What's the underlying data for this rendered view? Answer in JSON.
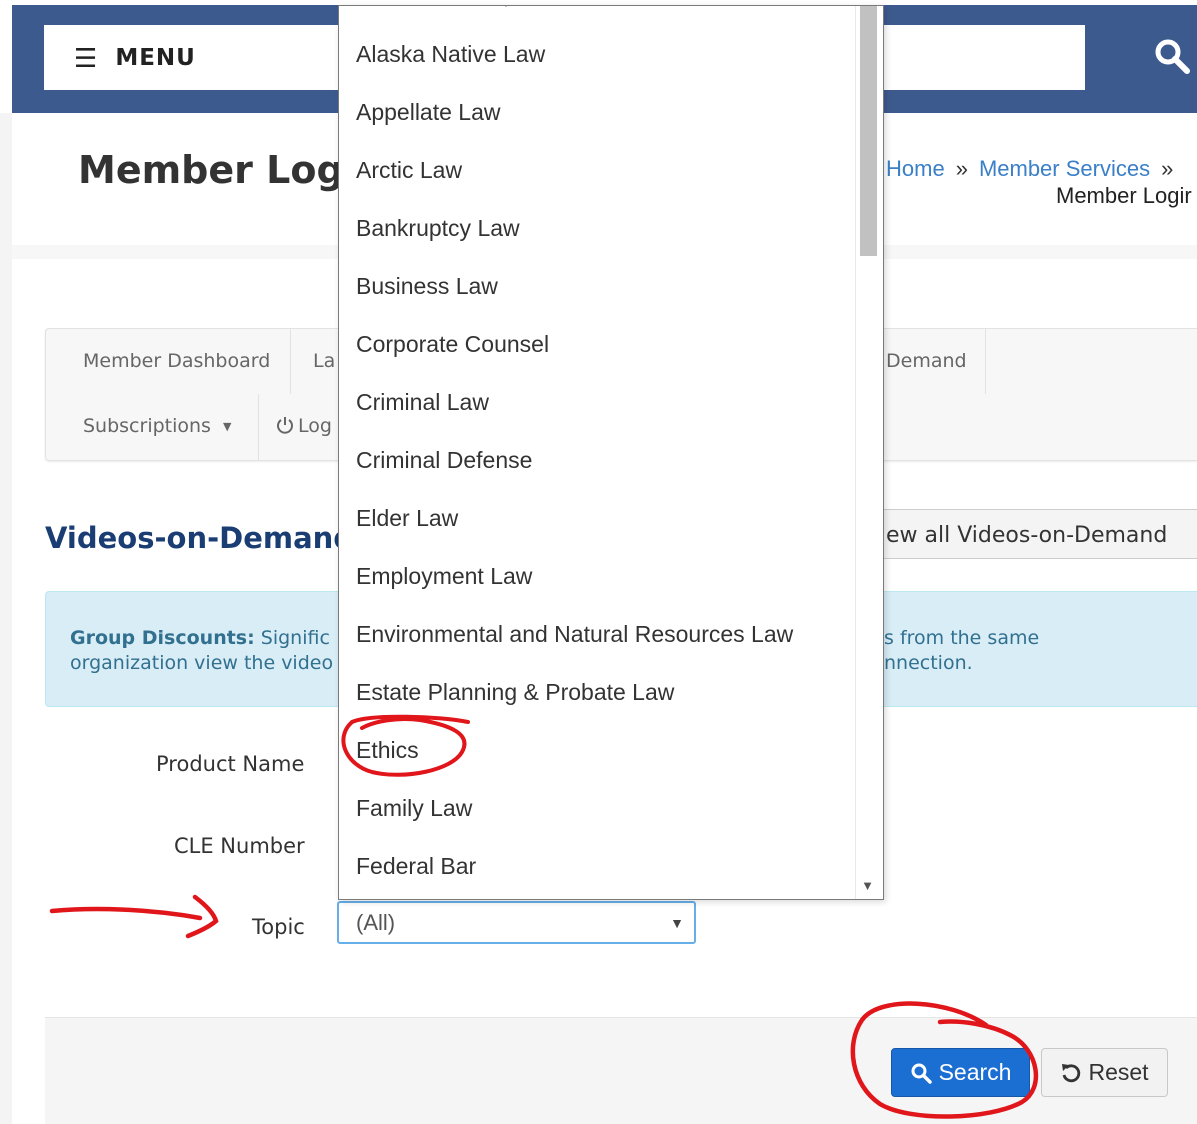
{
  "header": {
    "menu_label": "MENU"
  },
  "page": {
    "title": "Member Logi",
    "breadcrumb": {
      "home": "Home",
      "sep1": "»",
      "services": "Member Services",
      "sep2": "»",
      "current": "Member Logir"
    }
  },
  "nav": {
    "dashboard": "Member Dashboard",
    "la": "La",
    "demand": "Demand",
    "subscriptions": "Subscriptions",
    "logout": "Log"
  },
  "vod": {
    "heading": "Videos-on-Demand",
    "view_all": "ew all Videos-on-Demand"
  },
  "alert": {
    "bold": "Group Discounts:",
    "line1_rest": " Signific",
    "line1_right": "s from the same",
    "line2_left": "organization view the video",
    "line2_right": "nnection."
  },
  "form": {
    "product_name_label": "Product Name",
    "cle_number_label": "CLE Number",
    "topic_label": "Topic",
    "topic_value": "(All)",
    "caret": "▼"
  },
  "buttons": {
    "search": "Search",
    "reset": "Reset"
  },
  "dropdown": {
    "options": [
      "Alaska Native Law",
      "Appellate Law",
      "Arctic Law",
      "Bankruptcy Law",
      "Business Law",
      "Corporate Counsel",
      "Criminal Law",
      "Criminal Defense",
      "Elder Law",
      "Employment Law",
      "Environmental and Natural Resources Law",
      "Estate Planning & Probate Law",
      "Ethics",
      "Family Law",
      "Federal Bar"
    ],
    "scroll_arrow": "▼"
  },
  "colors": {
    "header_bg": "#3d5a8f",
    "link": "#3a7fc8",
    "heading_blue": "#1a3d73",
    "alert_bg": "#d9edf7",
    "alert_text": "#31708f",
    "search_btn": "#1c6fd2",
    "annotation_red": "#e0161b"
  },
  "icons": {
    "menu": "hamburger-icon",
    "search": "magnifier-icon",
    "power": "power-icon",
    "reset": "undo-icon",
    "caret": "caret-down-icon"
  }
}
